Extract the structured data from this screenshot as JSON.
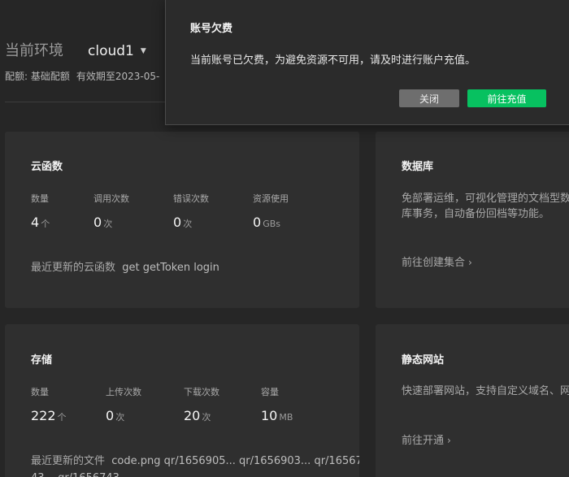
{
  "header": {
    "env_label": "当前环境",
    "env_value": "cloud1",
    "plan_label": "配额:",
    "plan_value": "基础配额",
    "validity": "有效期至2023-05-"
  },
  "cards": {
    "functions": {
      "title": "云函数",
      "stats": [
        {
          "label": "数量",
          "value": "4",
          "unit": "个"
        },
        {
          "label": "调用次数",
          "value": "0",
          "unit": "次"
        },
        {
          "label": "错误次数",
          "value": "0",
          "unit": "次"
        },
        {
          "label": "资源使用",
          "value": "0",
          "unit": "GBs"
        }
      ],
      "recent_label": "最近更新的云函数",
      "recent_items": "get  getToken  login"
    },
    "database": {
      "title": "数据库",
      "desc_line1": "免部署运维，可视化管理的文档型数",
      "desc_line2": "库事务，自动备份回档等功能。",
      "link": "前往创建集合"
    },
    "storage": {
      "title": "存储",
      "stats": [
        {
          "label": "数量",
          "value": "222",
          "unit": "个"
        },
        {
          "label": "上传次数",
          "value": "0",
          "unit": "次"
        },
        {
          "label": "下载次数",
          "value": "20",
          "unit": "次"
        },
        {
          "label": "容量",
          "value": "10",
          "unit": "MB"
        }
      ],
      "recent_label": "最近更新的文件",
      "recent_line1": "code.png  qr/1656905...  qr/1656903...  qr/16567",
      "recent_line2": "43...  qr/1656743..."
    },
    "hosting": {
      "title": "静态网站",
      "desc_line1": "快速部署网站，支持自定义域名、网",
      "link": "前往开通"
    }
  },
  "dialog": {
    "title": "账号欠费",
    "message": "当前账号已欠费，为避免资源不可用，请及时进行账户充值。",
    "close_label": "关闭",
    "recharge_label": "前往充值"
  },
  "colors": {
    "background": "#262626",
    "card": "#2f2f2f",
    "primary_button": "#07c160",
    "secondary_button": "#6e6e6e"
  }
}
